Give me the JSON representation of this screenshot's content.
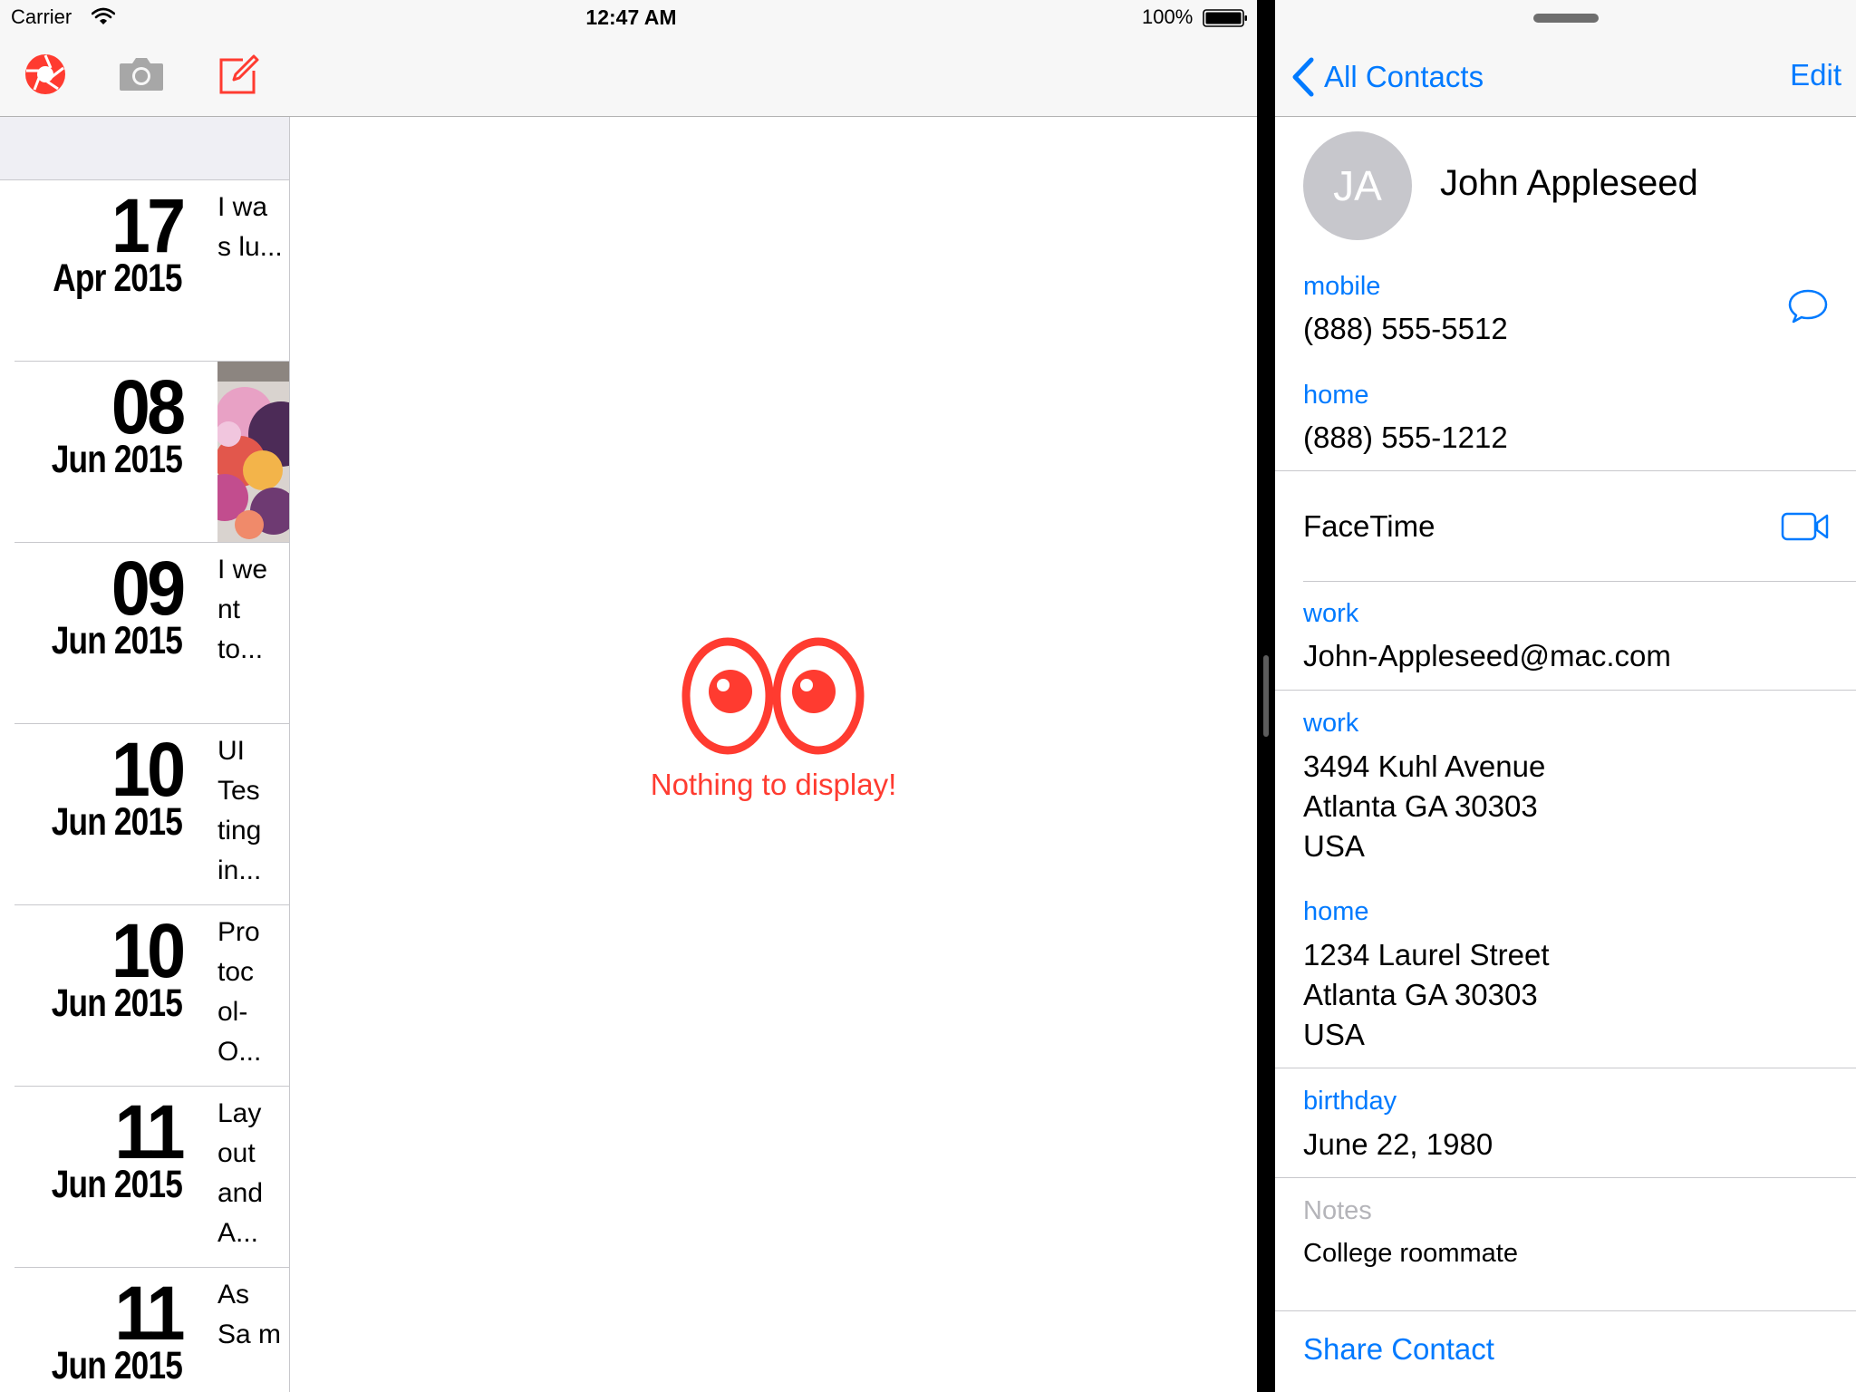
{
  "status_bar": {
    "carrier": "Carrier",
    "time": "12:47 AM",
    "battery": "100%"
  },
  "toolbar": {
    "buttons": [
      {
        "icon": "shutter-icon",
        "color": "#ff3b30"
      },
      {
        "icon": "camera-icon",
        "color": "#a0a0a0"
      },
      {
        "icon": "compose-icon",
        "color": "#ff3b30"
      }
    ]
  },
  "entries": [
    {
      "day": "17",
      "month_year": "Apr 2015",
      "snippet": "I wa s lu..."
    },
    {
      "day": "08",
      "month_year": "Jun 2015",
      "snippet": ""
    },
    {
      "day": "09",
      "month_year": "Jun 2015",
      "snippet": "I we nt to..."
    },
    {
      "day": "10",
      "month_year": "Jun 2015",
      "snippet": "UI Tes ting in..."
    },
    {
      "day": "10",
      "month_year": "Jun 2015",
      "snippet": "Pro toc ol- O..."
    },
    {
      "day": "11",
      "month_year": "Jun 2015",
      "snippet": "Lay out and A..."
    },
    {
      "day": "11",
      "month_year": "Jun 2015",
      "snippet": "As Sa m"
    }
  ],
  "detail": {
    "empty_text": "Nothing to display!",
    "accent": "#ff3b30"
  },
  "contacts": {
    "back_label": "All Contacts",
    "edit_label": "Edit",
    "initials": "JA",
    "name": "John Appleseed",
    "phone_mobile_label": "mobile",
    "phone_mobile": "(888) 555-5512",
    "phone_home_label": "home",
    "phone_home": "(888) 555-1212",
    "facetime_label": "FaceTime",
    "email_label": "work",
    "email": "John-Appleseed@mac.com",
    "address_work_label": "work",
    "address_work": [
      "3494 Kuhl Avenue",
      "Atlanta GA 30303",
      "USA"
    ],
    "address_home_label": "home",
    "address_home": [
      "1234 Laurel Street",
      "Atlanta GA 30303",
      "USA"
    ],
    "birthday_label": "birthday",
    "birthday": "June 22, 1980",
    "notes_label": "Notes",
    "notes": "College roommate",
    "share_label": "Share Contact",
    "accent": "#007aff"
  }
}
